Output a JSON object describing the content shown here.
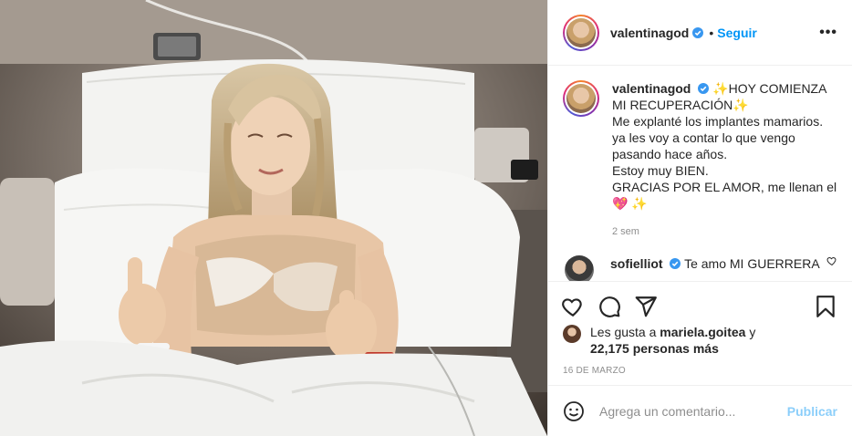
{
  "post": {
    "photo_alt": "Foto de la publicación",
    "author": {
      "username": "valentinagod",
      "verified": true,
      "follow_label": "Seguir",
      "more_label": "•••"
    },
    "caption": {
      "username": "valentinagod",
      "line1": "HOY COMIENZA MI RECUPERACIÓN",
      "line2": "Me explanté los implantes mamarios.",
      "line3": "ya les voy a contar lo que vengo pasando hace años.",
      "line4": "Estoy muy BIEN.",
      "line5": "GRACIAS POR EL AMOR, me llenan el",
      "time": "2 sem"
    },
    "comments": [
      {
        "username": "sofielliot",
        "verified": true,
        "text": "Te amo MI GUERRERA"
      }
    ],
    "actions": {
      "icons": [
        "heart-icon",
        "comment-icon",
        "share-icon",
        "bookmark-icon"
      ]
    },
    "likes": {
      "prefix": "Les gusta a",
      "liker": "mariela.goitea",
      "conj": "y",
      "others": "22,175 personas más"
    },
    "date": "16 DE MARZO",
    "add_comment": {
      "placeholder": "Agrega un comentario...",
      "post_label": "Publicar"
    }
  },
  "colors": {
    "link_blue": "#0095f6",
    "text": "#262626",
    "muted": "#8e8e8e",
    "border": "#efefef"
  }
}
